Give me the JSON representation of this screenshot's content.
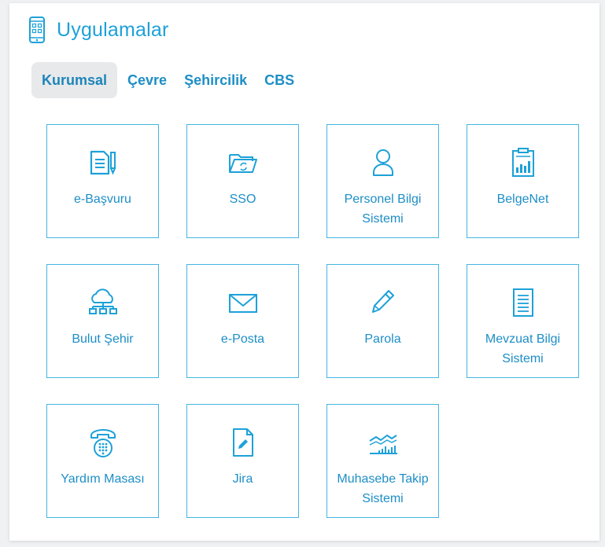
{
  "header": {
    "title": "Uygulamalar",
    "icon": "mobile-apps-icon",
    "accent_color": "#1da1d8"
  },
  "tabs": [
    {
      "label": "Kurumsal",
      "active": true
    },
    {
      "label": "Çevre",
      "active": false
    },
    {
      "label": "Şehircilik",
      "active": false
    },
    {
      "label": "CBS",
      "active": false
    }
  ],
  "apps": [
    {
      "label": "e-Başvuru",
      "icon": "document-pen-icon"
    },
    {
      "label": "SSO",
      "icon": "folder-sync-icon"
    },
    {
      "label": "Personel Bilgi Sistemi",
      "icon": "person-icon"
    },
    {
      "label": "BelgeNet",
      "icon": "clipboard-chart-icon"
    },
    {
      "label": "Bulut Şehir",
      "icon": "cloud-network-icon"
    },
    {
      "label": "e-Posta",
      "icon": "envelope-icon"
    },
    {
      "label": "Parola",
      "icon": "pencil-icon"
    },
    {
      "label": "Mevzuat Bilgi Sistemi",
      "icon": "document-lines-icon"
    },
    {
      "label": "Yardım Masası",
      "icon": "telephone-icon"
    },
    {
      "label": "Jira",
      "icon": "document-edit-icon"
    },
    {
      "label": "Muhasebe Takip Sistemi",
      "icon": "line-chart-icon"
    }
  ],
  "colors": {
    "card_border": "#45b6e2",
    "text": "#1d8ec6",
    "tab_active_bg": "#e8e9eb"
  }
}
